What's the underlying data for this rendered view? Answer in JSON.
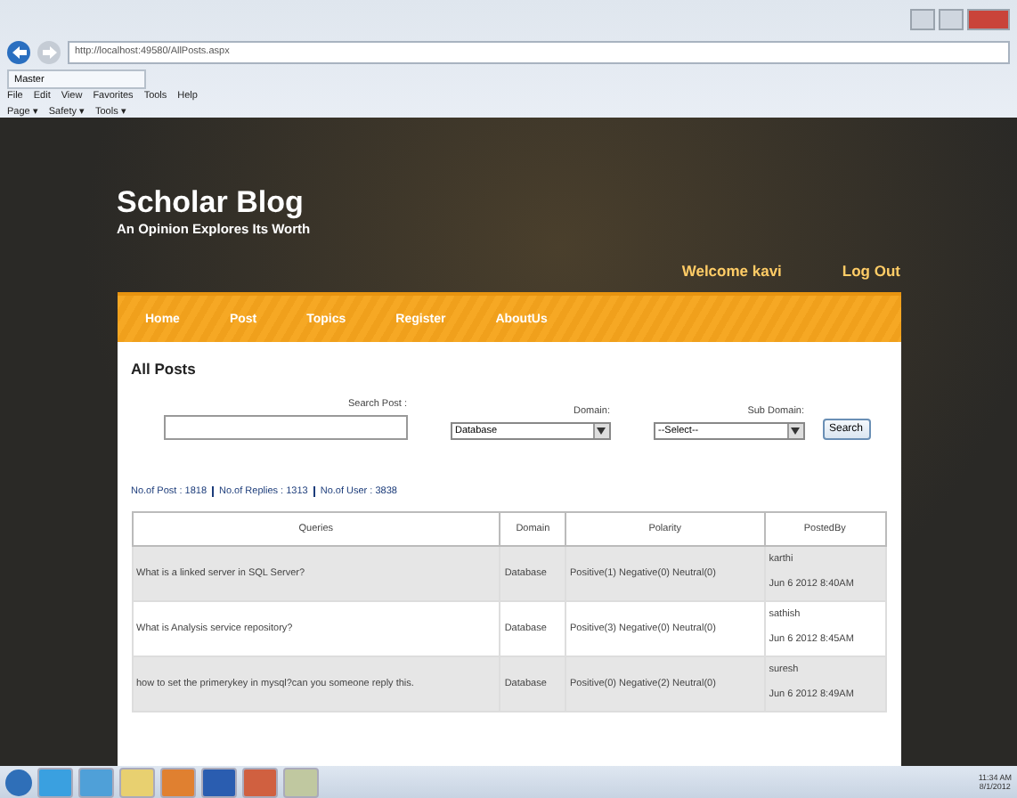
{
  "browser": {
    "address": "http://localhost:49580/AllPosts.aspx",
    "tab": "Master",
    "menu": [
      "File",
      "Edit",
      "View",
      "Favorites",
      "Tools",
      "Help"
    ],
    "commands": [
      "Page ▾",
      "Safety ▾",
      "Tools ▾"
    ]
  },
  "header": {
    "title": "Scholar Blog",
    "tagline": "An Opinion Explores Its Worth",
    "welcome": "Welcome kavi",
    "logout": "Log Out"
  },
  "nav": [
    "Home",
    "Post",
    "Topics",
    "Register",
    "AboutUs"
  ],
  "heading": "All Posts",
  "search": {
    "label": "Search Post :",
    "domain_label": "Domain:",
    "domain_value": "Database",
    "subdomain_label": "Sub Domain:",
    "subdomain_value": "--Select--",
    "button": "Search"
  },
  "stats": [
    "No.of Post : 1818",
    "No.of Replies : 1313",
    "No.of User : 3838"
  ],
  "table": {
    "columns": [
      "Queries",
      "Domain",
      "Polarity",
      "PostedBy"
    ],
    "rows": [
      {
        "query": "What is a linked server in SQL Server?",
        "domain": "Database",
        "polarity": "Positive(1) Negative(0) Neutral(0)",
        "user": "karthi",
        "date": "Jun 6 2012 8:40AM"
      },
      {
        "query": "What is Analysis service repository?",
        "domain": "Database",
        "polarity": "Positive(3) Negative(0) Neutral(0)",
        "user": "sathish",
        "date": "Jun 6 2012 8:45AM"
      },
      {
        "query": "how to set the primerykey in mysql?can you someone reply this.",
        "domain": "Database",
        "polarity": "Positive(0) Negative(2) Neutral(0)",
        "user": "suresh",
        "date": "Jun 6 2012 8:49AM"
      }
    ]
  },
  "taskbar": {
    "time": "11:34 AM",
    "date": "8/1/2012"
  }
}
